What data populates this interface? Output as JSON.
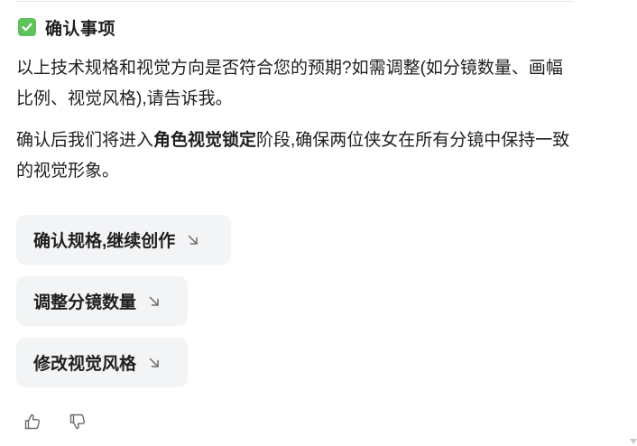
{
  "section": {
    "title": "确认事项",
    "title_icon": "check-box-icon",
    "accent_color": "#5ec25a"
  },
  "paragraphs": {
    "p1": "以上技术规格和视觉方向是否符合您的预期?如需调整(如分镜数量、画幅比例、视觉风格),请告诉我。",
    "p2_before": "确认后我们将进入",
    "p2_bold": "角色视觉锁定",
    "p2_after": "阶段,确保两位侠女在所有分镜中保持一致的视觉形象。"
  },
  "suggestions": [
    {
      "label": "确认规格,继续创作",
      "icon": "arrow-down-right-icon"
    },
    {
      "label": "调整分镜数量",
      "icon": "arrow-down-right-icon"
    },
    {
      "label": "修改视觉风格",
      "icon": "arrow-down-right-icon"
    }
  ],
  "feedback": {
    "like_icon": "thumbs-up-icon",
    "dislike_icon": "thumbs-down-icon"
  },
  "colors": {
    "text": "#1f1f1f",
    "chip_bg": "#f3f4f6",
    "icon_gray": "#6b6b6b"
  }
}
